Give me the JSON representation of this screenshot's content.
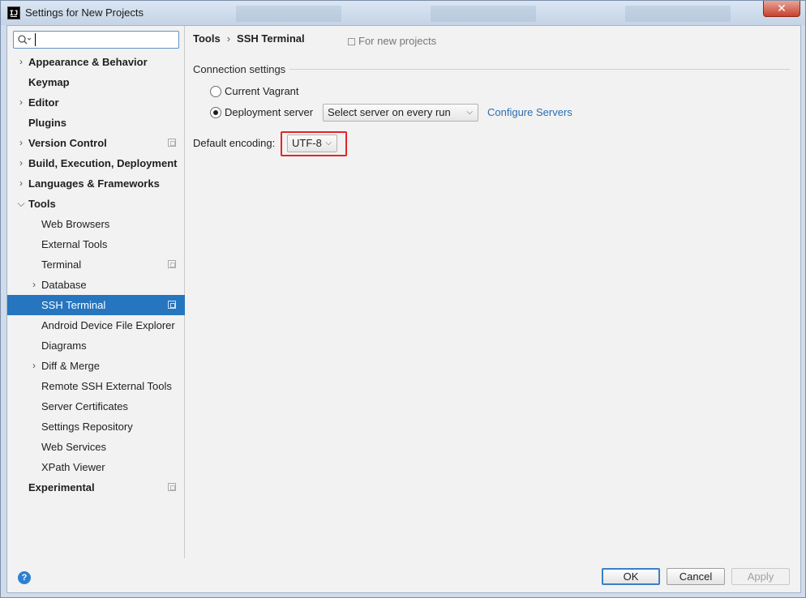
{
  "window": {
    "title": "Settings for New Projects",
    "close_glyph": "✕",
    "icon_label": "IJ"
  },
  "sidebar": {
    "search": {
      "value": "",
      "placeholder": ""
    },
    "items": [
      {
        "label": "Appearance & Behavior",
        "level": 0,
        "bold": true,
        "expandable": true,
        "expanded": false,
        "project_icon": false,
        "selected": false
      },
      {
        "label": "Keymap",
        "level": 0,
        "bold": true,
        "expandable": false,
        "expanded": false,
        "project_icon": false,
        "selected": false
      },
      {
        "label": "Editor",
        "level": 0,
        "bold": true,
        "expandable": true,
        "expanded": false,
        "project_icon": false,
        "selected": false
      },
      {
        "label": "Plugins",
        "level": 0,
        "bold": true,
        "expandable": false,
        "expanded": false,
        "project_icon": false,
        "selected": false
      },
      {
        "label": "Version Control",
        "level": 0,
        "bold": true,
        "expandable": true,
        "expanded": false,
        "project_icon": true,
        "selected": false
      },
      {
        "label": "Build, Execution, Deployment",
        "level": 0,
        "bold": true,
        "expandable": true,
        "expanded": false,
        "project_icon": false,
        "selected": false
      },
      {
        "label": "Languages & Frameworks",
        "level": 0,
        "bold": true,
        "expandable": true,
        "expanded": false,
        "project_icon": false,
        "selected": false
      },
      {
        "label": "Tools",
        "level": 0,
        "bold": true,
        "expandable": true,
        "expanded": true,
        "project_icon": false,
        "selected": false
      },
      {
        "label": "Web Browsers",
        "level": 1,
        "bold": false,
        "expandable": false,
        "expanded": false,
        "project_icon": false,
        "selected": false
      },
      {
        "label": "External Tools",
        "level": 1,
        "bold": false,
        "expandable": false,
        "expanded": false,
        "project_icon": false,
        "selected": false
      },
      {
        "label": "Terminal",
        "level": 1,
        "bold": false,
        "expandable": false,
        "expanded": false,
        "project_icon": true,
        "selected": false
      },
      {
        "label": "Database",
        "level": 1,
        "bold": false,
        "expandable": true,
        "expanded": false,
        "project_icon": false,
        "selected": false
      },
      {
        "label": "SSH Terminal",
        "level": 1,
        "bold": false,
        "expandable": false,
        "expanded": false,
        "project_icon": true,
        "selected": true
      },
      {
        "label": "Android Device File Explorer",
        "level": 1,
        "bold": false,
        "expandable": false,
        "expanded": false,
        "project_icon": false,
        "selected": false
      },
      {
        "label": "Diagrams",
        "level": 1,
        "bold": false,
        "expandable": false,
        "expanded": false,
        "project_icon": false,
        "selected": false
      },
      {
        "label": "Diff & Merge",
        "level": 1,
        "bold": false,
        "expandable": true,
        "expanded": false,
        "project_icon": false,
        "selected": false
      },
      {
        "label": "Remote SSH External Tools",
        "level": 1,
        "bold": false,
        "expandable": false,
        "expanded": false,
        "project_icon": false,
        "selected": false
      },
      {
        "label": "Server Certificates",
        "level": 1,
        "bold": false,
        "expandable": false,
        "expanded": false,
        "project_icon": false,
        "selected": false
      },
      {
        "label": "Settings Repository",
        "level": 1,
        "bold": false,
        "expandable": false,
        "expanded": false,
        "project_icon": false,
        "selected": false
      },
      {
        "label": "Web Services",
        "level": 1,
        "bold": false,
        "expandable": false,
        "expanded": false,
        "project_icon": false,
        "selected": false
      },
      {
        "label": "XPath Viewer",
        "level": 1,
        "bold": false,
        "expandable": false,
        "expanded": false,
        "project_icon": false,
        "selected": false
      },
      {
        "label": "Experimental",
        "level": 0,
        "bold": true,
        "expandable": false,
        "expanded": false,
        "project_icon": true,
        "selected": false
      }
    ]
  },
  "content": {
    "breadcrumb": {
      "parent": "Tools",
      "separator": "›",
      "current": "SSH Terminal"
    },
    "scope_label": "For new projects",
    "connection_section_title": "Connection settings",
    "radio_current_vagrant": {
      "label": "Current Vagrant",
      "checked": false
    },
    "radio_deployment_server": {
      "label": "Deployment server",
      "checked": true
    },
    "server_select": {
      "value": "Select server on every run"
    },
    "configure_servers_link": "Configure Servers",
    "encoding_label": "Default encoding:",
    "encoding_select": {
      "value": "UTF-8"
    },
    "highlight_color": "#e0262a"
  },
  "footer": {
    "help_glyph": "?",
    "ok_label": "OK",
    "cancel_label": "Cancel",
    "apply_label": "Apply",
    "apply_enabled": false
  },
  "colors": {
    "selection": "#2675bf",
    "link": "#2a6fb0",
    "panel_bg": "#f2f2f2"
  }
}
